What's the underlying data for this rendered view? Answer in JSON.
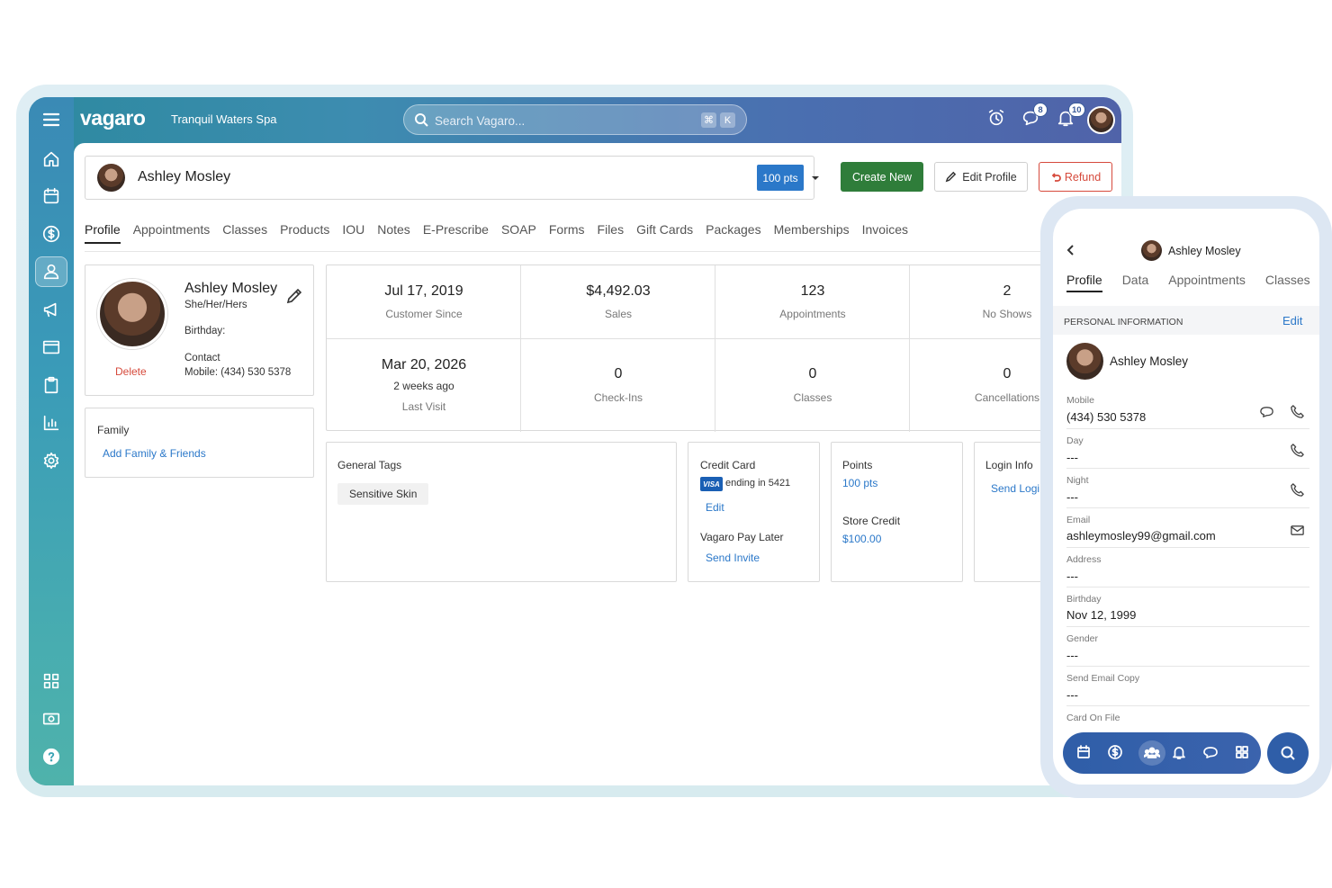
{
  "app": {
    "logo": "vagaro",
    "business": "Tranquil Waters Spa",
    "search_placeholder": "Search Vagaro...",
    "shortcut_keys": [
      "⌘",
      "K"
    ],
    "messages_badge": "8",
    "notifications_badge": "10"
  },
  "client": {
    "name": "Ashley Mosley",
    "points_button": "100 pts",
    "create_new": "Create New",
    "edit_profile": "Edit Profile",
    "refund": "Refund"
  },
  "tabs": [
    "Profile",
    "Appointments",
    "Classes",
    "Products",
    "IOU",
    "Notes",
    "E-Prescribe",
    "SOAP",
    "Forms",
    "Files",
    "Gift Cards",
    "Packages",
    "Memberships",
    "Invoices"
  ],
  "profile_card": {
    "name": "Ashley Mosley",
    "pronouns": "She/Her/Hers",
    "birthday_label": "Birthday:",
    "contact_label": "Contact",
    "mobile": "Mobile: (434) 530 5378",
    "delete": "Delete"
  },
  "family": {
    "title": "Family",
    "add_link": "Add Family & Friends"
  },
  "stats": [
    {
      "value": "Jul 17, 2019",
      "label": "Customer Since"
    },
    {
      "value": "$4,492.03",
      "label": "Sales"
    },
    {
      "value": "123",
      "label": "Appointments"
    },
    {
      "value": "2",
      "label": "No Shows"
    },
    {
      "value": "Mar 20, 2026",
      "sub": "2 weeks ago",
      "label": "Last Visit"
    },
    {
      "value": "0",
      "label": "Check-Ins"
    },
    {
      "value": "0",
      "label": "Classes"
    },
    {
      "value": "0",
      "label": "Cancellations"
    }
  ],
  "tags": {
    "title": "General Tags",
    "items": [
      "Sensitive Skin"
    ]
  },
  "credit_card": {
    "title": "Credit Card",
    "brand": "VISA",
    "ending": "ending in 5421",
    "edit": "Edit",
    "pay_later": "Vagaro Pay Later",
    "send_invite": "Send Invite"
  },
  "points": {
    "title": "Points",
    "value": "100 pts",
    "store_credit_label": "Store Credit",
    "store_credit": "$100.00"
  },
  "login": {
    "title": "Login Info",
    "link": "Send Logi"
  },
  "phone": {
    "name": "Ashley Mosley",
    "tabs": [
      "Profile",
      "Data",
      "Appointments",
      "Classes"
    ],
    "section": "PERSONAL INFORMATION",
    "edit": "Edit",
    "person_name": "Ashley Mosley",
    "fields": [
      {
        "key": "Mobile",
        "value": "(434) 530 5378"
      },
      {
        "key": "Day",
        "value": "---"
      },
      {
        "key": "Night",
        "value": "---"
      },
      {
        "key": "Email",
        "value": "ashleymosley99@gmail.com"
      },
      {
        "key": "Address",
        "value": "---"
      },
      {
        "key": "Birthday",
        "value": "Nov 12, 1999"
      },
      {
        "key": "Gender",
        "value": "---"
      },
      {
        "key": "Send Email Copy",
        "value": "---"
      },
      {
        "key": "Card On File",
        "value": ""
      }
    ]
  },
  "colors": {
    "primary_blue": "#2b78c9",
    "create_green": "#2f7d3a",
    "refund_red": "#d64a3c"
  }
}
